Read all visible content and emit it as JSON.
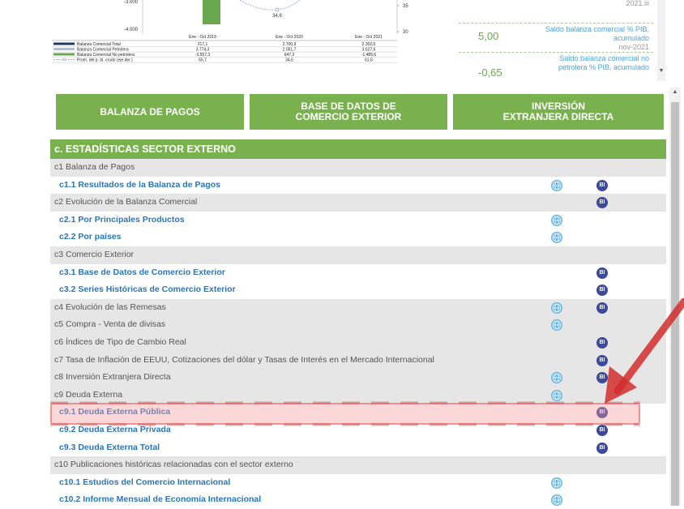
{
  "chart_data": {
    "type": "bar",
    "categories": [
      "Ene - Oct 2019",
      "Ene - Oct 2020",
      "Ene - Oct 2021"
    ],
    "y_ticks_left": [
      "-3.000",
      "-4.000"
    ],
    "y_ticks_right": [
      "35",
      "30"
    ],
    "point_label": "34,6",
    "series": [
      {
        "name": "Balanza Comercial Total",
        "values": [
          "217,1",
          "2.700,9",
          "2.302,0"
        ],
        "color": "#1f3864"
      },
      {
        "name": "Balanza Comercial Petrolera",
        "values": [
          "3.774,3",
          "2.051,7",
          "3.627,6"
        ],
        "color": "#9dc3e6"
      },
      {
        "name": "Balanza Comercial No petrolera",
        "values": [
          "-3.557,3",
          "647,2",
          "-1.485,6"
        ],
        "color": "#6aa84f"
      },
      {
        "name": "Prom. del p. bl. crudo (eje der.)",
        "values": [
          "55,7",
          "34,6",
          "61,6"
        ],
        "color": "#7f9cc9"
      }
    ]
  },
  "indicators": [
    {
      "value": "",
      "label": "",
      "date": "2021.iii",
      "color": "#999999"
    },
    {
      "value": "5,00",
      "label_lines": [
        "Saldo balanza comercial % PIB,",
        "acumulado"
      ],
      "date": "nov-2021",
      "color": "#6aa84f"
    },
    {
      "value": "-0,65",
      "label_lines": [
        "Saldo balanza comercial no",
        "petrolera % PIB, acumulado"
      ],
      "date": "",
      "color": "#6aa84f"
    }
  ],
  "buttons": [
    {
      "lines": [
        "BALANZA DE PAGOS"
      ]
    },
    {
      "lines": [
        "BASE DE DATOS DE",
        "COMERCIO EXTERIOR"
      ]
    },
    {
      "lines": [
        "INVERSIÓN",
        "EXTRANJERA DIRECTA"
      ]
    }
  ],
  "stats": {
    "header": "c. ESTADÍSTICAS SECTOR EXTERNO",
    "bi_label": "BI",
    "rows": [
      {
        "label": "c1 Balanza de Pagos",
        "type": "sec",
        "globe": false,
        "bi": false
      },
      {
        "label": "c1.1 Resultados de la Balanza de Pagos",
        "type": "sub",
        "globe": true,
        "bi": true
      },
      {
        "label": "c2 Evolución de la Balanza Comercial",
        "type": "sec",
        "globe": false,
        "bi": true
      },
      {
        "label": "c2.1 Por Principales Productos",
        "type": "sub",
        "globe": true,
        "bi": false
      },
      {
        "label": "c2.2 Por países",
        "type": "sub",
        "globe": true,
        "bi": false
      },
      {
        "label": "c3 Comercio Exterior",
        "type": "sec",
        "globe": false,
        "bi": false
      },
      {
        "label": "c3.1 Base de Datos de Comercio Exterior",
        "type": "sub",
        "globe": false,
        "bi": true
      },
      {
        "label": "c3.2 Series Históricas de Comercio Exterior",
        "type": "sub",
        "globe": false,
        "bi": true
      },
      {
        "label": "c4 Evolución de las Remesas",
        "type": "sec",
        "globe": true,
        "bi": true
      },
      {
        "label": "c5 Compra - Venta de divisas",
        "type": "sec",
        "globe": true,
        "bi": false
      },
      {
        "label": "c6 Índices de Tipo de Cambio Real",
        "type": "sec",
        "globe": false,
        "bi": true
      },
      {
        "label": "c7 Tasa de Inflación de EEUU, Cotizaciones del dólar y Tasas de Interés en el Mercado Internacional",
        "type": "sec",
        "globe": false,
        "bi": true
      },
      {
        "label": "c8 Inversión Extranjera Directa",
        "type": "sec",
        "globe": true,
        "bi": true
      },
      {
        "label": "c9 Deuda Externa",
        "type": "sec",
        "globe": true,
        "bi": false
      },
      {
        "label": "c9.1 Deuda Externa Pública",
        "type": "sub",
        "globe": false,
        "bi": true
      },
      {
        "label": "c9.2 Deuda Externa Privada",
        "type": "sub",
        "globe": false,
        "bi": true
      },
      {
        "label": "c9.3 Deuda Externa Total",
        "type": "sub",
        "globe": false,
        "bi": true
      },
      {
        "label": "c10 Publicaciones históricas relacionadas con el sector externo",
        "type": "sec",
        "globe": false,
        "bi": false
      },
      {
        "label": "c10.1 Estudios del Comercio Internacional",
        "type": "sub",
        "globe": true,
        "bi": false
      },
      {
        "label": "c10.2 Informe Mensual de Economía Internacional",
        "type": "sub",
        "globe": true,
        "bi": false
      }
    ]
  }
}
